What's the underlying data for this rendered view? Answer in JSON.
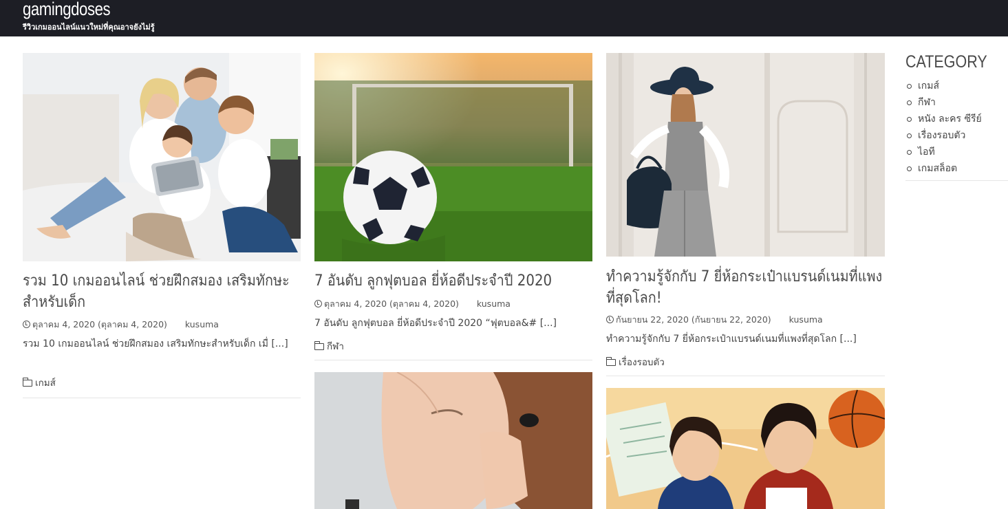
{
  "site": {
    "title": "gamingdoses",
    "tagline": "รีวิวเกมออนไลน์แนวใหม่ที่คุณอาจยังไม่รู้"
  },
  "posts": [
    {
      "title": "รวม 10 เกมออนไลน์ ช่วยฝึกสมอง เสริมทักษะสำหรับเด็ก",
      "date": "ตุลาคม 4, 2020 (ตุลาคม 4, 2020)",
      "author": "kusuma",
      "excerpt": "รวม 10 เกมออนไลน์ ช่วยฝึกสมอง เสริมทักษะสำหรับเด็ก เมื่ [...]",
      "category": "เกมส์",
      "image": "family-with-tablet"
    },
    {
      "title": "7 อันดับ ลูกฟุตบอล ยี่ห้อดีประจำปี 2020",
      "date": "ตุลาคม 4, 2020 (ตุลาคม 4, 2020)",
      "author": "kusuma",
      "excerpt": "7 อันดับ ลูกฟุตบอล ยี่ห้อดีประจำปี 2020 “ฟุตบอล&# [...]",
      "category": "กีฬา",
      "image": "soccer-ball-on-grass"
    },
    {
      "title": "ทำความรู้จักกับ 7 ยี่ห้อกระเป๋าแบรนด์เนมที่แพงที่สุดโลก!",
      "date": "กันยายน 22, 2020 (กันยายน 22, 2020)",
      "author": "kusuma",
      "excerpt": "ทำความรู้จักกับ 7 ยี่ห้อกระเป๋าแบรนด์เนมที่แพงที่สุดโลก [...]",
      "category": "เรื่องรอบตัว",
      "image": "fashion-woman-with-handbag"
    },
    {
      "image": "woman-with-earbud"
    },
    {
      "image": "two-young-men-basketball"
    }
  ],
  "sidebar": {
    "heading": "CATEGORY",
    "categories": [
      "เกมส์",
      "กีฬา",
      "หนัง ละคร ซีรีย์",
      "เรื่องรอบตัว",
      "ไอที",
      "เกมสล็อต"
    ]
  }
}
